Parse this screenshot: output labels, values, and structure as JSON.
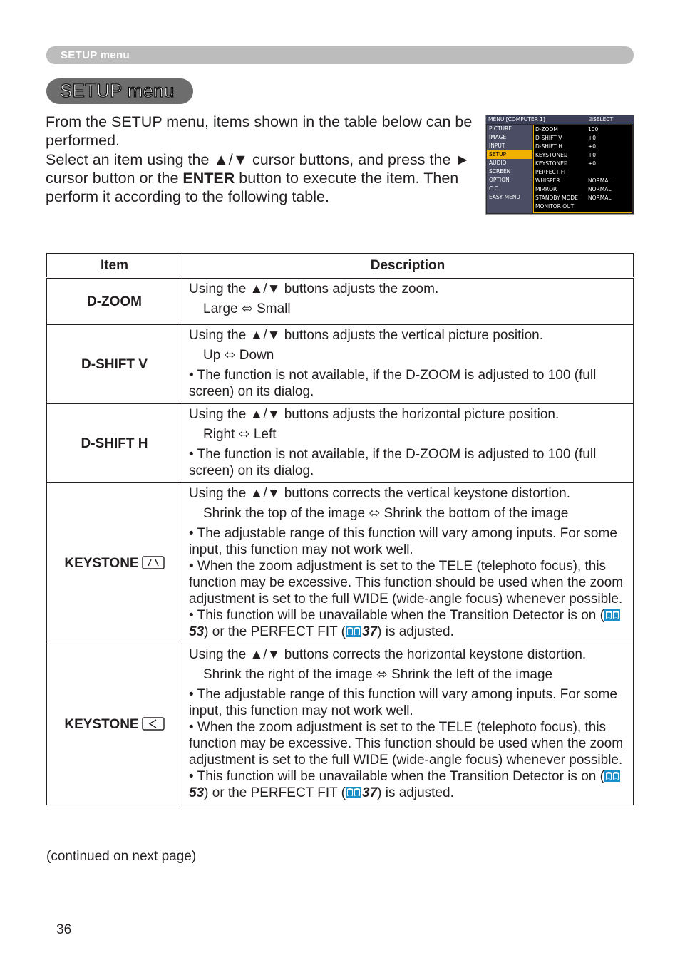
{
  "running_header": "SETUP menu",
  "title": "SETUP menu",
  "intro": {
    "line1": "From the SETUP menu, items shown in the table below can be performed.",
    "line2_pre": "Select an item using the ▲/▼ cursor buttons, and press the ► cursor button or the ",
    "line2_bold": "ENTER",
    "line2_post": " button to execute the item. Then perform it according to the following table."
  },
  "osd": {
    "header_title": "MENU [COMPUTER 1]",
    "header_hint": "SELECT",
    "left_items": [
      "PICTURE",
      "IMAGE",
      "INPUT",
      "SETUP",
      "AUDIO",
      "SCREEN",
      "OPTION",
      "C.C.",
      "EASY MENU"
    ],
    "selected_left": "SETUP",
    "right_items": [
      {
        "name": "D-ZOOM",
        "value": "100"
      },
      {
        "name": "D-SHIFT V",
        "value": "+0"
      },
      {
        "name": "D-SHIFT H",
        "value": "+0"
      },
      {
        "name": "KEYSTONE",
        "value": "+0"
      },
      {
        "name": "KEYSTONE",
        "value": "+0"
      },
      {
        "name": "PERFECT FIT",
        "value": ""
      },
      {
        "name": "WHISPER",
        "value": "NORMAL"
      },
      {
        "name": "MIRROR",
        "value": "NORMAL"
      },
      {
        "name": "STANDBY MODE",
        "value": "NORMAL"
      },
      {
        "name": "MONITOR OUT",
        "value": ""
      }
    ]
  },
  "table": {
    "headers": {
      "item": "Item",
      "description": "Description"
    },
    "rows": [
      {
        "item": "D-ZOOM",
        "lead": "Using the ▲/▼ buttons adjusts the zoom.",
        "range": "Large ⬄ Small"
      },
      {
        "item": "D-SHIFT V",
        "lead": "Using the ▲/▼ buttons adjusts the vertical picture position.",
        "range": "Up ⬄ Down",
        "note": "• The function is not available, if the D-ZOOM is adjusted to 100 (full screen) on its dialog."
      },
      {
        "item": "D-SHIFT H",
        "lead": "Using the ▲/▼ buttons adjusts the horizontal picture position.",
        "range": "Right ⬄ Left",
        "note": "• The function is not available, if the D-ZOOM is adjusted to 100 (full screen) on its dialog."
      },
      {
        "item": "KEYSTONE",
        "icon": "vertical-keystone-icon",
        "lead": "Using the ▲/▼ buttons corrects the vertical keystone distortion.",
        "range": "Shrink the top of the image ⬄ Shrink the bottom of the image",
        "note1": "• The adjustable range of this function will vary among inputs. For some input, this function may not work well.",
        "note2": "• When the zoom adjustment is set to the TELE (telephoto focus), this function may be excessive. This function should be used when the zoom adjustment is set to the full WIDE (wide-angle focus) whenever possible.",
        "note3_a": "• This function will be unavailable when the Transition Detector is on (",
        "ref1": "53",
        "note3_b": ") or the PERFECT FIT (",
        "ref2": "37",
        "note3_c": ") is adjusted."
      },
      {
        "item": "KEYSTONE",
        "icon": "horizontal-keystone-icon",
        "lead": "Using the ▲/▼ buttons corrects the horizontal keystone distortion.",
        "range": "Shrink the right of the image ⬄ Shrink the left of the image",
        "note1": "• The adjustable range of this function will vary among inputs. For some input, this function may not work well.",
        "note2": "• When the zoom adjustment is set to the TELE (telephoto focus), this function may be excessive. This function should be used when the zoom adjustment is set to the full WIDE (wide-angle focus) whenever possible.",
        "note3_a": "• This function will be unavailable when the Transition Detector is on (",
        "ref1": "53",
        "note3_b": ") or the PERFECT FIT (",
        "ref2": "37",
        "note3_c": ") is adjusted."
      }
    ]
  },
  "continued": "(continued on next page)",
  "page_number": "36",
  "colors": {
    "book_icon": "#1a8fc8",
    "osd_highlight": "#f0b000",
    "running_header_bg": "#bcbcbc",
    "title_pill_bg": "#6d6d6d"
  }
}
